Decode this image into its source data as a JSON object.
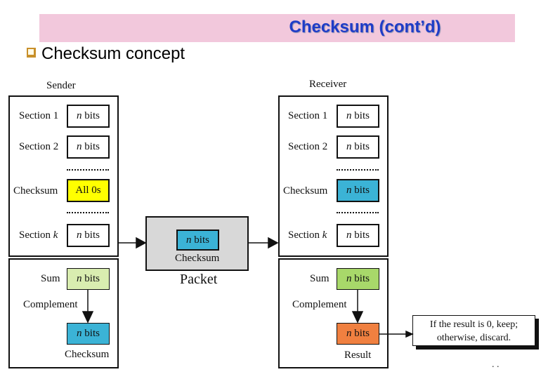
{
  "header": {
    "title": "Checksum (cont’d)",
    "bullet_icon": "checkbox-bullet-icon",
    "subtitle": "Checksum concept"
  },
  "sender": {
    "heading": "Sender",
    "sections": [
      {
        "label": "Section 1",
        "value_var": "n",
        "value_unit": " bits"
      },
      {
        "label": "Section 2",
        "value_var": "n",
        "value_unit": " bits"
      },
      {
        "label": "Checksum",
        "value": "All 0s"
      },
      {
        "label": "Section ",
        "label_var": "k",
        "value_var": "n",
        "value_unit": " bits"
      }
    ],
    "sum_label": "Sum",
    "sum_value_var": "n",
    "sum_value_unit": " bits",
    "complement_label": "Complement",
    "checksum_value_var": "n",
    "checksum_value_unit": " bits",
    "checksum_label": "Checksum"
  },
  "packet": {
    "inner_value_var": "n",
    "inner_value_unit": " bits",
    "inner_label": "Checksum",
    "label": "Packet"
  },
  "receiver": {
    "heading": "Receiver",
    "sections": [
      {
        "label": "Section 1",
        "value_var": "n",
        "value_unit": " bits"
      },
      {
        "label": "Section 2",
        "value_var": "n",
        "value_unit": " bits"
      },
      {
        "label": "Checksum",
        "value_var": "n",
        "value_unit": " bits"
      },
      {
        "label": "Section ",
        "label_var": "k",
        "value_var": "n",
        "value_unit": " bits"
      }
    ],
    "sum_label": "Sum",
    "sum_value_var": "n",
    "sum_value_unit": " bits",
    "complement_label": "Complement",
    "result_value_var": "n",
    "result_value_unit": " bits",
    "result_label": "Result"
  },
  "decision": {
    "line1": "If the result is 0, keep;",
    "line2": "otherwise, discard."
  },
  "footer_mark": ". ."
}
